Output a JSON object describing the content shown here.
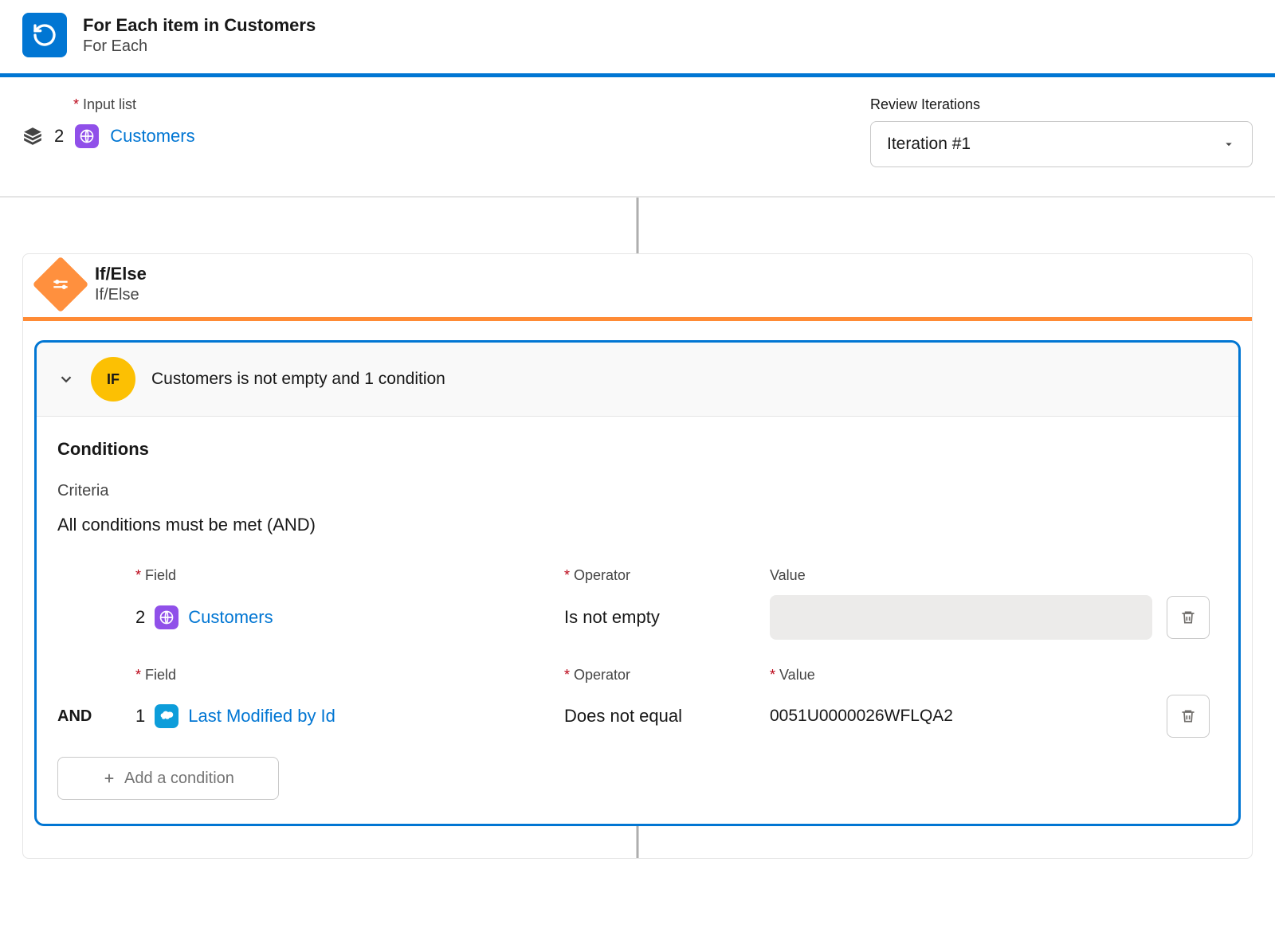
{
  "foreach": {
    "title": "For Each item in Customers",
    "subtitle": "For Each"
  },
  "input": {
    "label": "Input list",
    "step": "2",
    "pillName": "Customers"
  },
  "review": {
    "label": "Review Iterations",
    "value": "Iteration #1"
  },
  "ifelse": {
    "title": "If/Else",
    "subtitle": "If/Else"
  },
  "ifBranch": {
    "badge": "IF",
    "summary": "Customers is not empty and 1 condition"
  },
  "conditions": {
    "heading": "Conditions",
    "criteriaLabel": "Criteria",
    "criteriaValue": "All conditions must be met (AND)",
    "labels": {
      "field": "Field",
      "operator": "Operator",
      "value": "Value"
    },
    "rows": [
      {
        "and": "",
        "step": "2",
        "fieldName": "Customers",
        "operator": "Is not empty",
        "value": "",
        "valueRequired": false,
        "badge": "globe"
      },
      {
        "and": "AND",
        "step": "1",
        "fieldName": "Last Modified by Id",
        "operator": "Does not equal",
        "value": "0051U0000026WFLQA2",
        "valueRequired": true,
        "badge": "salesforce"
      }
    ],
    "addLabel": "Add a condition"
  }
}
